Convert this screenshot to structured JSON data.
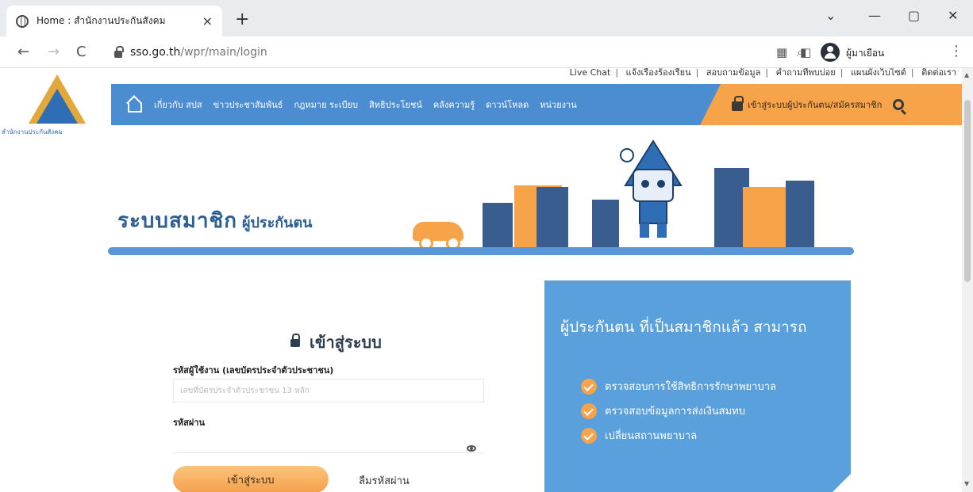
{
  "browser": {
    "tab_title": "Home : สำนักงานประกันสังคม",
    "tab_close": "×",
    "new_tab": "+",
    "window_controls": {
      "dropdown": "⌄",
      "minimize": "—",
      "maximize": "▢",
      "close": "✕"
    },
    "nav": {
      "back": "←",
      "forward": "→",
      "reload": "C"
    },
    "url_host": "sso.go.th",
    "url_path": "/wpr/main/login",
    "profile_name": "ผู้มาเยือน",
    "kebab": "⋮"
  },
  "site": {
    "logo_text": "สำนักงานประกันสังคม",
    "top_links": [
      "Live Chat",
      "แจ้งเรื่องร้องเรียน",
      "สอบถามข้อมูล",
      "คำถามที่พบบ่อย",
      "แผนผังเว็บไซต์",
      "ติดต่อเรา"
    ],
    "nav_items": [
      "เกี่ยวกับ สปส",
      "ข่าวประชาสัมพันธ์",
      "กฎหมาย ระเบียบ",
      "สิทธิประโยชน์",
      "คลังความรู้",
      "ดาวน์โหลด",
      "หน่วยงาน"
    ],
    "nav_login_label": "เข้าสู่ระบบผู้ประกันตน/สมัครสมาชิก"
  },
  "hero": {
    "title_big": "ระบบสมาชิก",
    "title_small": "ผู้ประกันตน"
  },
  "login": {
    "title": "เข้าสู่ระบบ",
    "username_label": "รหัสผู้ใช้งาน (เลขบัตรประจำตัวประชาชน)",
    "username_placeholder": "เลขที่บัตรประจำตัวประชาชน 13 หลัก",
    "password_label": "รหัสผ่าน",
    "submit_label": "เข้าสู่ระบบ",
    "forgot_label": "ลืมรหัสผ่าน"
  },
  "info": {
    "heading": "ผู้ประกันตน ที่เป็นสมาชิกแล้ว สามารถ",
    "items": [
      "ตรวจสอบการใช้สิทธิการรักษาพยาบาล",
      "ตรวจสอบข้อมูลการส่งเงินสมทบ",
      "เปลี่ยนสถานพยาบาล"
    ]
  },
  "colors": {
    "nav_blue": "#4b8dd0",
    "accent_orange": "#f6a34a",
    "info_blue": "#5aa0dc",
    "title_blue": "#2c5f93"
  }
}
